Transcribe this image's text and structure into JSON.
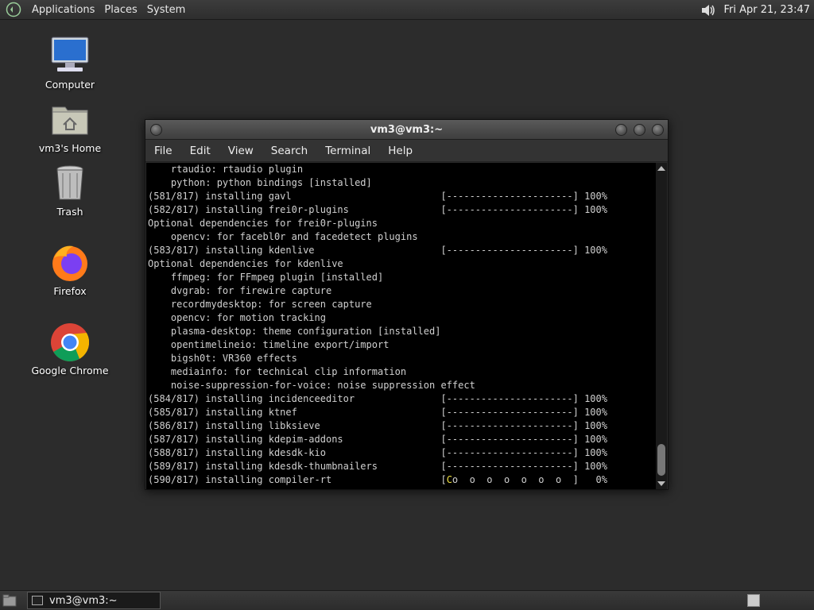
{
  "top_panel": {
    "menus": [
      "Applications",
      "Places",
      "System"
    ],
    "clock": "Fri Apr 21, 23:47"
  },
  "desktop_icons": [
    {
      "label": "Computer",
      "icon": "computer-icon"
    },
    {
      "label": "vm3's Home",
      "icon": "home-folder-icon"
    },
    {
      "label": "Trash",
      "icon": "trash-icon"
    },
    {
      "label": "Firefox",
      "icon": "firefox-icon"
    },
    {
      "label": "Google Chrome",
      "icon": "chrome-icon"
    }
  ],
  "terminal": {
    "title": "vm3@vm3:~",
    "menu": [
      "File",
      "Edit",
      "View",
      "Search",
      "Terminal",
      "Help"
    ],
    "lines": [
      "    rtaudio: rtaudio plugin",
      "    python: python bindings [installed]",
      "(581/817) installing gavl                          [----------------------] 100%",
      "(582/817) installing frei0r-plugins                [----------------------] 100%",
      "Optional dependencies for frei0r-plugins",
      "    opencv: for facebl0r and facedetect plugins",
      "(583/817) installing kdenlive                      [----------------------] 100%",
      "Optional dependencies for kdenlive",
      "    ffmpeg: for FFmpeg plugin [installed]",
      "    dvgrab: for firewire capture",
      "    recordmydesktop: for screen capture",
      "    opencv: for motion tracking",
      "    plasma-desktop: theme configuration [installed]",
      "    opentimelineio: timeline export/import",
      "    bigsh0t: VR360 effects",
      "    mediainfo: for technical clip information",
      "    noise-suppression-for-voice: noise suppression effect",
      "(584/817) installing incidenceeditor               [----------------------] 100%",
      "(585/817) installing ktnef                         [----------------------] 100%",
      "(586/817) installing libksieve                     [----------------------] 100%",
      "(587/817) installing kdepim-addons                 [----------------------] 100%",
      "(588/817) installing kdesdk-kio                    [----------------------] 100%",
      "(589/817) installing kdesdk-thumbnailers           [----------------------] 100%"
    ],
    "last_line_prefix": "(590/817) installing compiler-rt                   [",
    "last_line_pacman": "C",
    "last_line_dots": "o  o  o  o  o  o  o  ]   0%"
  },
  "taskbar": {
    "task_label": "vm3@vm3:~"
  }
}
